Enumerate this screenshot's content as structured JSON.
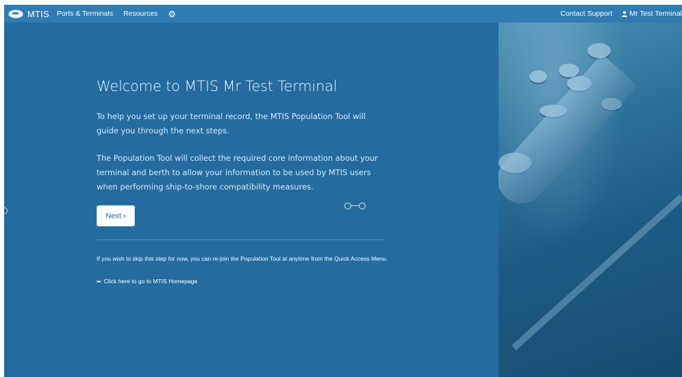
{
  "navbar": {
    "brand": "MTIS",
    "links": [
      "Ports & Terminals",
      "Resources"
    ],
    "settings_icon": "gear-icon",
    "contact": "Contact Support",
    "user": "Mr Test Terminal",
    "user_icon": "user-icon"
  },
  "main": {
    "title": "Welcome to MTIS Mr Test Terminal",
    "paragraph1": "To help you set up your terminal record, the MTIS Population Tool will guide you through the next steps.",
    "paragraph2": "The Population Tool will collect the required core information about your terminal and berth to allow your information to be used by MTIS users when performing ship-to-shore compatibility measures.",
    "next_button": "Next ›",
    "skip_text": "If you wish to skip this step for now, you can re-join the Population Tool at anytime from the Quick Access Menu.",
    "home_link": "Click here to go to MTIS Homepage",
    "home_link_icon": "sign-out-icon"
  },
  "colors": {
    "navbar": "#2f7bb2",
    "background": "#236ba0",
    "button_text": "#236ba0"
  }
}
